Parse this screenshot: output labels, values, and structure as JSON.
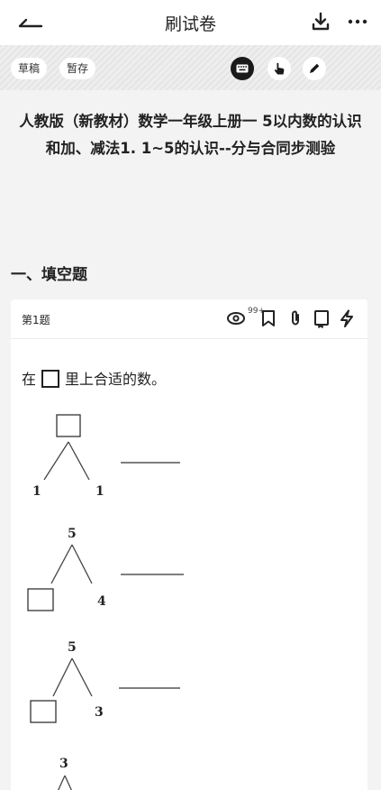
{
  "header": {
    "title": "刷试卷",
    "back_icon": "back-arrow-icon",
    "download_icon": "download-icon",
    "more_label": "···"
  },
  "toolbar": {
    "draft_label": "草稿",
    "save_label": "暂存",
    "icons": [
      "keyboard-icon",
      "hand-pointer-icon",
      "pencil-icon"
    ],
    "accent": "#1a1a1a"
  },
  "document": {
    "title": "人教版（新教材）数学一年级上册一 5以内数的认识和加、减法1. 1~5的认识--分与合同步测验"
  },
  "section": {
    "title": "一、填空题"
  },
  "question": {
    "number_label": "第1题",
    "view_count": "99+",
    "icons": [
      "eye-icon",
      "bookmark-icon",
      "attachment-icon",
      "notebook-icon",
      "lightning-icon"
    ],
    "text_before": "在",
    "text_after": "里上合适的数。",
    "trees": [
      {
        "top": "",
        "left": "1",
        "right": "1"
      },
      {
        "top": "5",
        "left": "",
        "right": "4"
      },
      {
        "top": "5",
        "left": "",
        "right": "3"
      },
      {
        "top": "3",
        "left": "",
        "right": ""
      }
    ]
  }
}
